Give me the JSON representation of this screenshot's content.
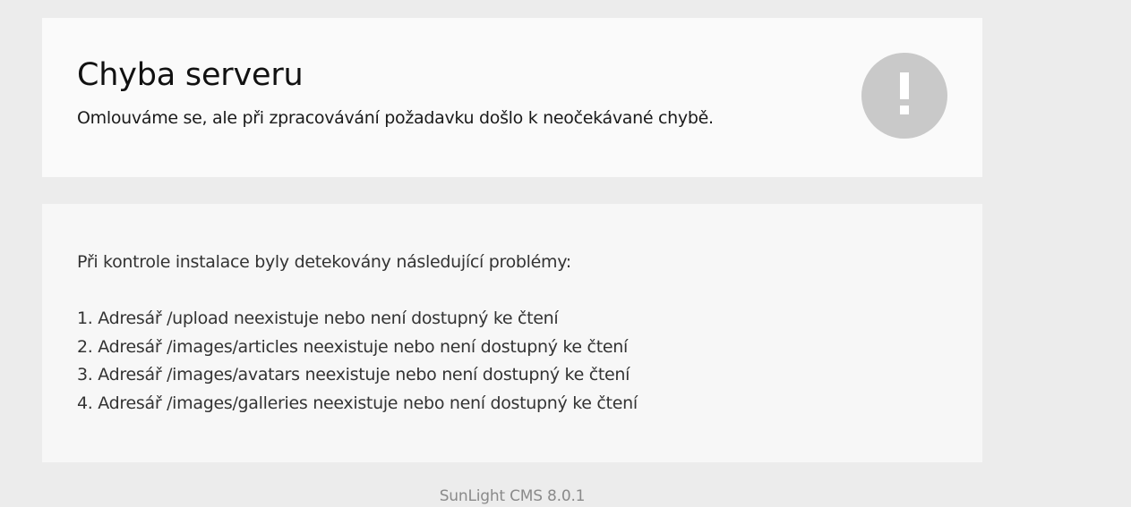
{
  "error": {
    "title": "Chyba serveru",
    "message": "Omlouváme se, ale při zpracovávání požadavku došlo k neočekávané chybě.",
    "icon": "exclamation-icon",
    "icon_color": "#c9c9c9"
  },
  "details": {
    "intro": "Při kontrole instalace byly detekovány následující problémy:",
    "problems": [
      "1. Adresář /upload neexistuje nebo není dostupný ke čtení",
      "2. Adresář /images/articles neexistuje nebo není dostupný ke čtení",
      "3. Adresář /images/avatars neexistuje nebo není dostupný ke čtení",
      "4. Adresář /images/galleries neexistuje nebo není dostupný ke čtení"
    ]
  },
  "footer": {
    "text": "SunLight CMS 8.0.1"
  },
  "colors": {
    "page_background": "#ececec",
    "panel_background": "#fafafa",
    "text": "#1a1a1a",
    "muted_text": "#8a8a8a"
  }
}
